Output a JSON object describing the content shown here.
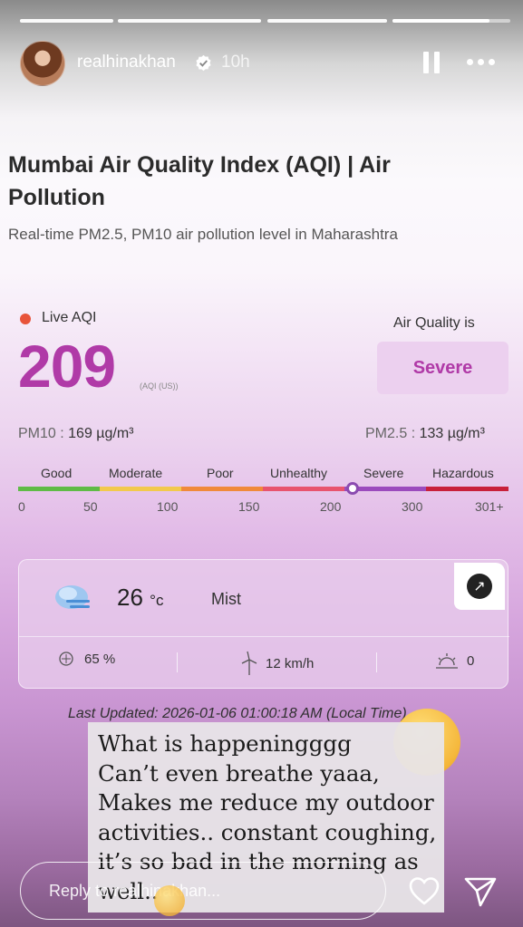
{
  "story": {
    "username": "realhinakhan",
    "timestamp": "10h",
    "reply_placeholder": "Reply to realhinakhan..."
  },
  "page": {
    "title": "Mumbai Air Quality Index (AQI) | Air Pollution",
    "subtitle": "Real-time PM2.5, PM10 air pollution level in Maharashtra"
  },
  "aqi": {
    "live_label": "Live AQI",
    "value": "209",
    "unit": "(AQI (US))",
    "quality_label": "Air Quality is",
    "quality_status": "Severe",
    "pm10_label": "PM10 :",
    "pm10_value": "169 µg/m³",
    "pm25_label": "PM2.5 :",
    "pm25_value": "133 µg/m³",
    "scale_categories": [
      "Good",
      "Moderate",
      "Poor",
      "Unhealthy",
      "Severe",
      "Hazardous"
    ],
    "scale_ticks": [
      "0",
      "50",
      "100",
      "150",
      "200",
      "300",
      "301+"
    ],
    "scale_colors": [
      "#5fbb46",
      "#f2c94c",
      "#f08a3a",
      "#e8546e",
      "#9b4bbd",
      "#c8203a"
    ],
    "marker_value": 209
  },
  "weather": {
    "temperature": "26",
    "temperature_unit": "°c",
    "condition": "Mist",
    "humidity": "65 %",
    "wind": "12 km/h",
    "uv": "0"
  },
  "last_updated": "Last Updated: 2026-01-06 01:00:18 AM (Local Time)",
  "caption": "What is happeningggg\nCan’t even breathe yaaa,\nMakes me reduce my outdoor\nactivities.. constant coughing,\nit’s so bad in the morning as\nwell.."
}
